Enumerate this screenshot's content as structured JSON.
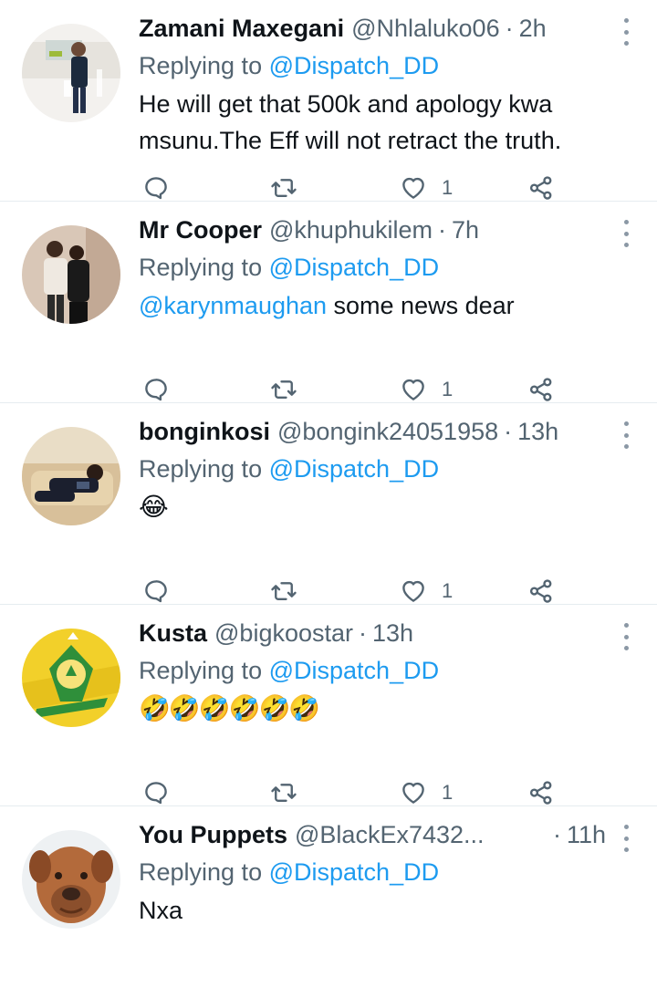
{
  "colors": {
    "accent": "#1d9bf0",
    "muted": "#536471",
    "text": "#0f1419",
    "divider": "#e6ecf0"
  },
  "tweets": [
    {
      "name": "Zamani Maxegani",
      "handle": "@Nhlaluko06",
      "time": "2h",
      "replying_prefix": "Replying to",
      "replying_to": "@Dispatch_DD",
      "body": "He will get that 500k and apology kwa msunu.The Eff will not retract the truth.",
      "likes": "1",
      "avatar_icon": "photo-man-standing-mall"
    },
    {
      "name": "Mr Cooper",
      "handle": "@khuphukilem",
      "time": "7h",
      "replying_prefix": "Replying to",
      "replying_to": "@Dispatch_DD",
      "body_mention": "@karynmaughan",
      "body": " some news dear",
      "likes": "1",
      "avatar_icon": "photo-couple"
    },
    {
      "name": "bonginkosi",
      "handle": "@bongink24051958",
      "time": "13h",
      "replying_prefix": "Replying to",
      "replying_to": "@Dispatch_DD",
      "body": "😂",
      "likes": "1",
      "avatar_icon": "photo-man-on-couch"
    },
    {
      "name": "Kusta",
      "handle": "@bigkoostar",
      "time": "13h",
      "replying_prefix": "Replying to",
      "replying_to": "@Dispatch_DD",
      "body": "🤣🤣🤣🤣🤣🤣",
      "likes": "1",
      "avatar_icon": "football-club-badge"
    },
    {
      "name": "You Puppets",
      "handle": "@BlackEx7432...",
      "time": "11h",
      "replying_prefix": "Replying to",
      "replying_to": "@Dispatch_DD",
      "body": "Nxa",
      "avatar_icon": "photo-dog"
    }
  ]
}
